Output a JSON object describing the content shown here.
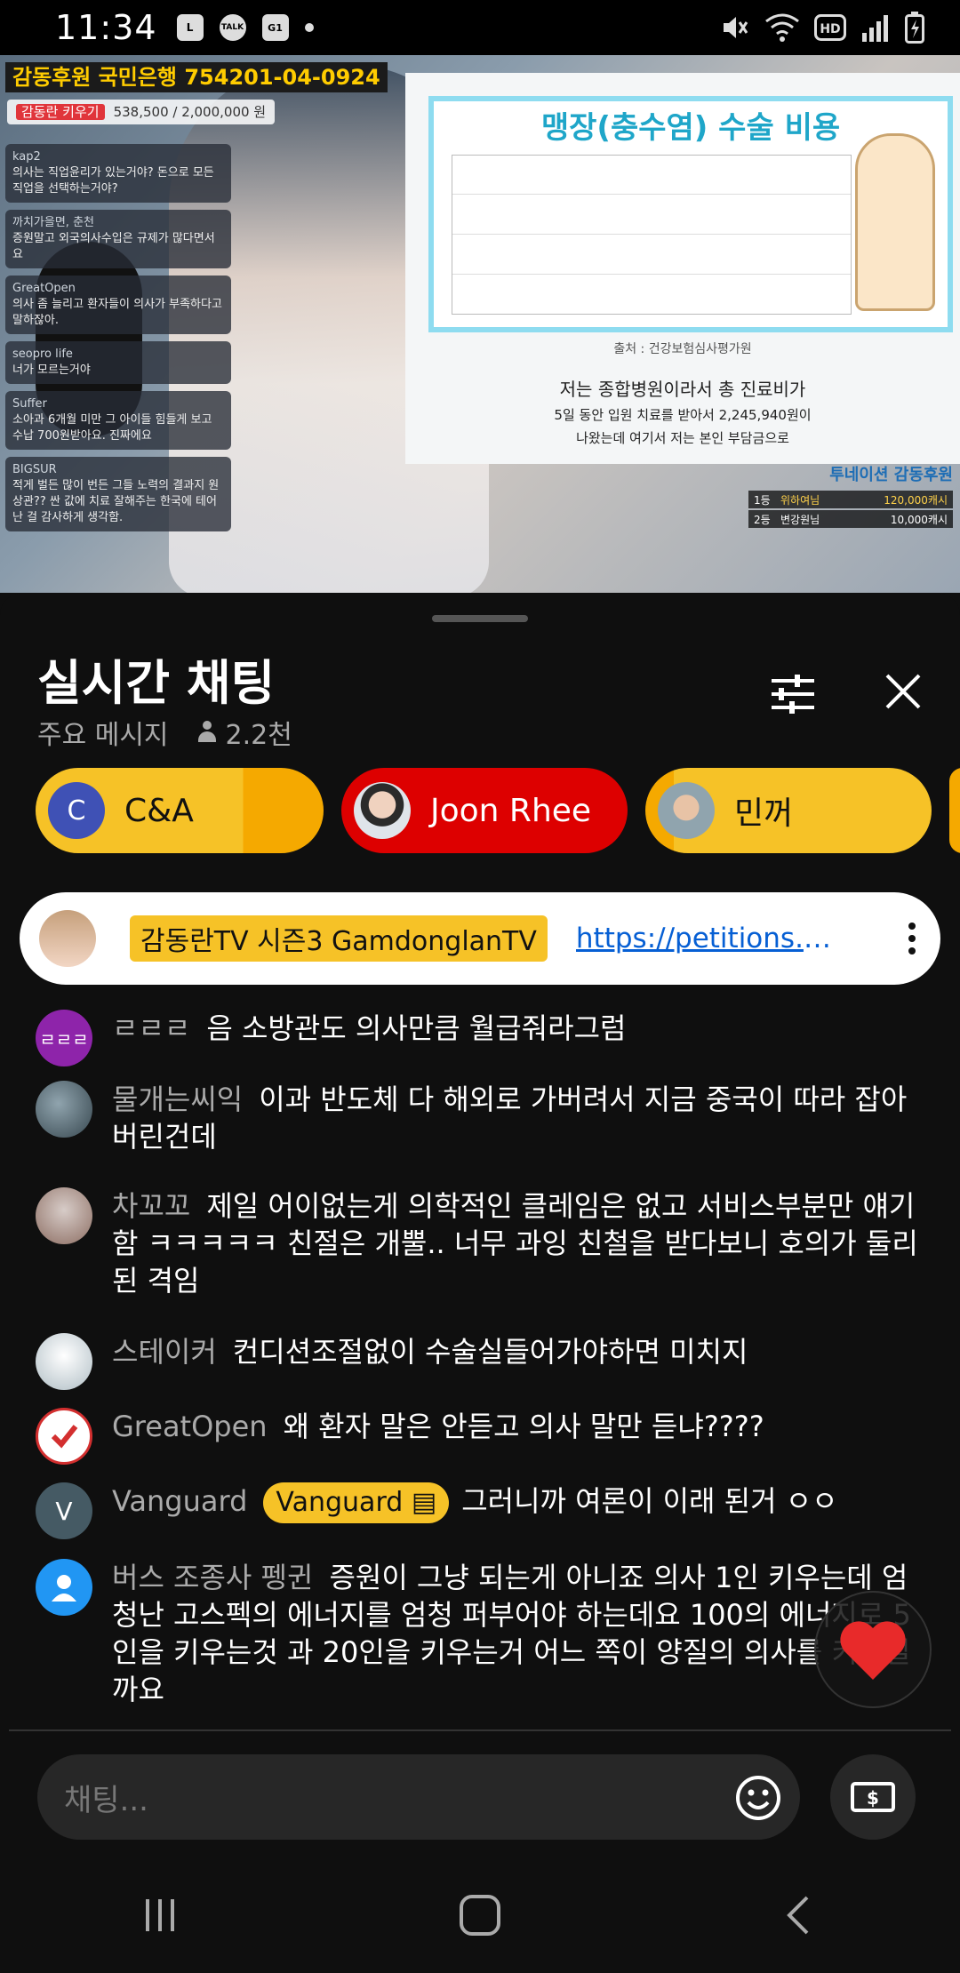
{
  "status_bar": {
    "time": "11:34",
    "left_icons": [
      "L",
      "TALK",
      "G1"
    ],
    "right_icons": [
      "mute-icon",
      "wifi-icon",
      "hd-icon",
      "signal-icon",
      "battery-icon"
    ]
  },
  "video": {
    "banner_text": "감동후원 국민은행 754201-04-0924",
    "goal_label": "감동란 키우기",
    "goal_value": "538,500 / 2,000,000 원",
    "overlay_chat": [
      {
        "name": "kap2",
        "text": "의사는 직업윤리가 있는거야? 돈으로 모든 직업을 선택하는거야?"
      },
      {
        "name": "까치가을면, 춘천",
        "text": "증원말고 외국의사수입은 규제가 많다면서요"
      },
      {
        "name": "GreatOpen",
        "text": "의사 좀 늘리고 환자들이 의사가 부족하다고 말하잖아."
      },
      {
        "name": "seopro life",
        "text": "너가 모르는거야"
      },
      {
        "name": "Suffer",
        "text": "소아과 6개월 미만 그 아이들 힘들게 보고 수납 700원받아요. 진짜에요"
      },
      {
        "name": "BIGSUR",
        "text": "적게 벌든 많이 번든 그들 노력의 결과지 원상관?? 싼 값에 치료 잘해주는 한국에 테어난 걸 감사하게 생각함."
      }
    ],
    "slide_title": "맹장(충수염) 수술 비용",
    "slide_source": "출처 : 건강보험심사평가원",
    "slide_caption_1": "저는 종합병원이라서 총 진료비가",
    "slide_caption_2": "5일 동안 입원 치료를 받아서 2,245,940원이",
    "slide_caption_3": "나왔는데 여기서 저는 본인 부담금으로",
    "ranking_title": "투네이션 감동후원",
    "ranking": [
      {
        "rank": "1등",
        "name": "위하여님",
        "amount": "120,000캐시"
      },
      {
        "rank": "2등",
        "name": "변강원님",
        "amount": "10,000캐시"
      }
    ]
  },
  "chat": {
    "title": "실시간 채팅",
    "filter_label": "주요 메시지",
    "viewer_count": "2.2천",
    "tickers": [
      {
        "avatar_letter": "C",
        "name": "C&A",
        "avatar_color": "#3f51b5"
      },
      {
        "avatar_letter": "",
        "name": "Joon Rhee",
        "avatar_color": "#dfe4ea"
      },
      {
        "avatar_letter": "",
        "name": "민꺼",
        "avatar_color": "#cfd8dc"
      }
    ],
    "pinned": {
      "author": "감동란TV 시즌3 GamdonglanTV",
      "link": "https://petitions.a..."
    },
    "messages": [
      {
        "avatar_letter": "",
        "avatar_color": "#37474f",
        "name": "",
        "badge": "",
        "text": "..."
      },
      {
        "avatar_letter": "ㄹㄹㄹ",
        "avatar_color": "#8e24aa",
        "name": "ㄹㄹㄹ",
        "badge": "",
        "text": "음 소방관도 의사만큼 월급줘라그럼"
      },
      {
        "avatar_letter": "",
        "avatar_color": "#546e7a",
        "name": "물개는씨익",
        "badge": "",
        "text": "이과 반도체 다 해외로 가버려서 지금 중국이 따라 잡아버린건데"
      },
      {
        "avatar_letter": "",
        "avatar_color": "#a1887f",
        "name": "차꼬꼬",
        "badge": "",
        "text": "제일 어이없는게 의학적인 클레임은 없고 서비스부분만 얘기함 ㅋㅋㅋㅋㅋ 친절은 개뿔.. 너무 과잉 친철을 받다보니 호의가 둘리된 격임"
      },
      {
        "avatar_letter": "",
        "avatar_color": "#b0bec5",
        "name": "스테이커",
        "badge": "",
        "text": "컨디션조절없이 수술실들어가야하면 미치지"
      },
      {
        "avatar_letter": "✔",
        "avatar_color": "#ffffff",
        "name": "GreatOpen",
        "badge": "",
        "text": "왜 환자 말은 안듣고 의사 말만 듣냐????"
      },
      {
        "avatar_letter": "V",
        "avatar_color": "#455a64",
        "name": "Vanguard",
        "badge": "Vanguard",
        "text": "그러니까 여론이 이래 된거 ㅇㅇ"
      },
      {
        "avatar_letter": "",
        "avatar_color": "#2196f3",
        "name": "버스 조종사 펭귄",
        "badge": "",
        "text": "증원이 그냥 되는게 아니죠 의사 1인 키우는데 엄청난 고스펙의 에너지를 엄청 퍼부어야 하는데요 100의 에너지로 5인을 키우는것 과 20인을 키우는거 어느 쪽이 양질의 의사를 키워낼까요"
      }
    ],
    "input_placeholder": "채팅..."
  },
  "nav": {
    "items": [
      "recents",
      "home",
      "back"
    ]
  }
}
